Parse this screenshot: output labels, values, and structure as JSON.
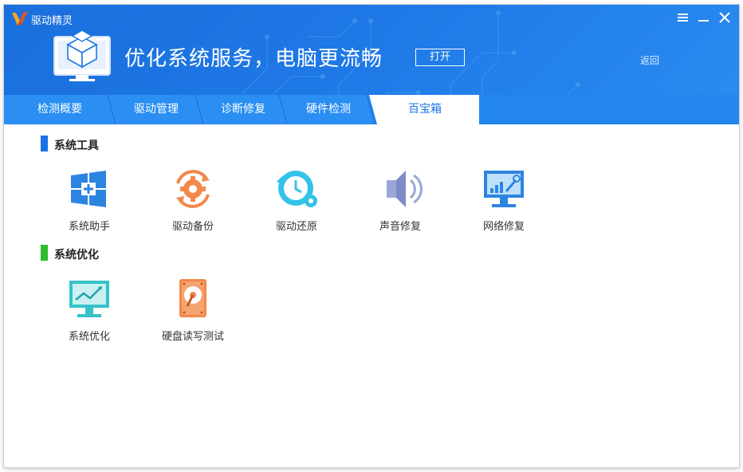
{
  "app": {
    "title": "驱动精灵"
  },
  "window_controls": {
    "menu_icon": "menu-icon",
    "minimize_icon": "minimize-icon",
    "close_icon": "close-icon"
  },
  "hero": {
    "title": "优化系统服务，电脑更流畅",
    "open_label": "打开",
    "back_label": "返回"
  },
  "tabs": [
    {
      "label": "检测概要"
    },
    {
      "label": "驱动管理"
    },
    {
      "label": "诊断修复"
    },
    {
      "label": "硬件检测"
    },
    {
      "label": "百宝箱",
      "active": true
    }
  ],
  "sections": [
    {
      "title": "系统工具",
      "color": "#1a73e8",
      "items": [
        {
          "label": "系统助手",
          "icon": "windows-plus-icon"
        },
        {
          "label": "驱动备份",
          "icon": "gear-backup-icon"
        },
        {
          "label": "驱动还原",
          "icon": "clock-restore-icon"
        },
        {
          "label": "声音修复",
          "icon": "speaker-icon"
        },
        {
          "label": "网络修复",
          "icon": "network-monitor-icon"
        }
      ]
    },
    {
      "title": "系统优化",
      "color": "#2dbd2d",
      "items": [
        {
          "label": "系统优化",
          "icon": "monitor-chart-icon"
        },
        {
          "label": "硬盘读写测试",
          "icon": "harddisk-icon"
        }
      ]
    }
  ],
  "colors": {
    "header": "#1e78e6",
    "accent": "#1a73e8",
    "orange": "#f2884b",
    "cyan": "#35c2e8"
  }
}
